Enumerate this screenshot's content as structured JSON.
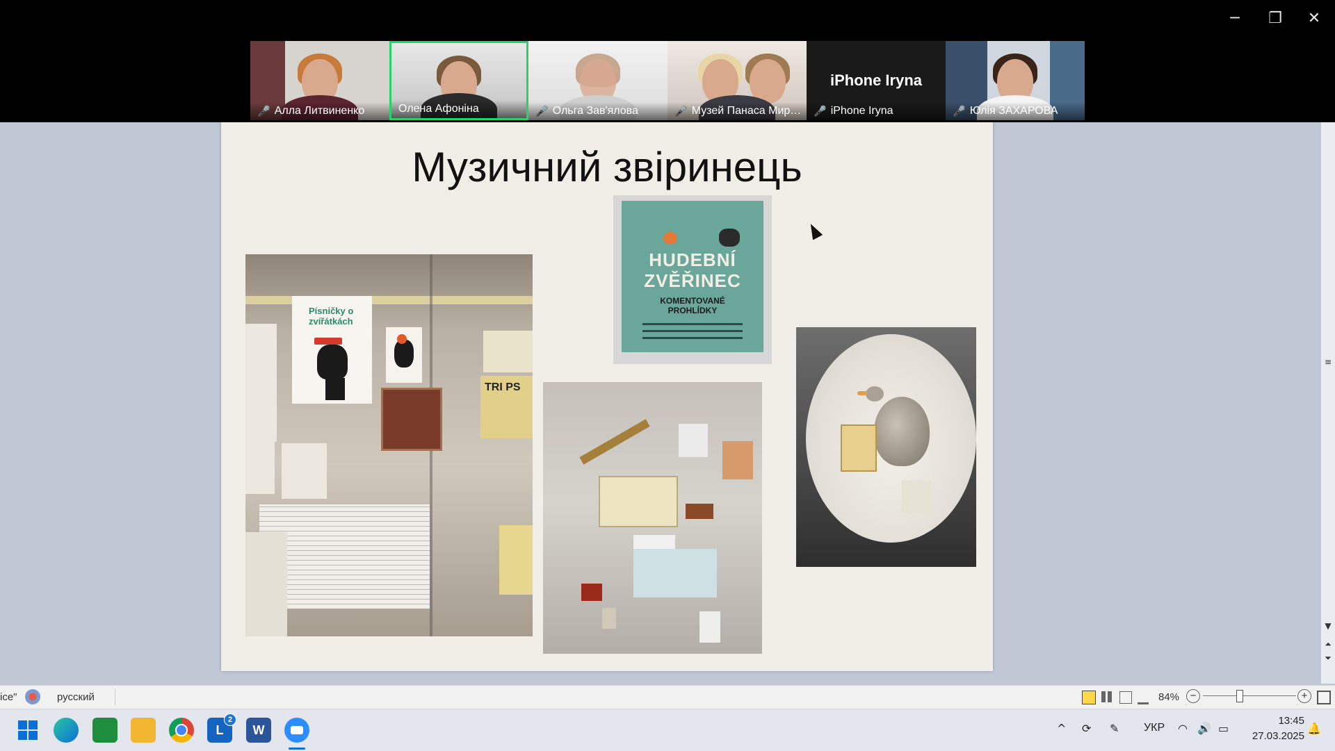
{
  "window": {
    "min_glyph": "─",
    "restore_glyph": "❐",
    "close_glyph": "✕"
  },
  "participants": [
    {
      "name": "Алла Литвиненко",
      "muted": true
    },
    {
      "name": "Олена Афоніна",
      "muted": false,
      "active": true
    },
    {
      "name": "Ольга Зав'ялова",
      "muted": true
    },
    {
      "name": "Музей Панаса Мирно...",
      "muted": true
    },
    {
      "name": "iPhone Iryna",
      "muted": true,
      "label": "iPhone Iryna"
    },
    {
      "name": "Юлія ЗАХАРОВА",
      "muted": true
    }
  ],
  "slide": {
    "title": "Музичний звіринець",
    "poster": {
      "title_line1": "HUDEBNÍ",
      "title_line2": "ZVĚŘINEC",
      "subtitle_line1": "KOMENTOVANÉ",
      "subtitle_line2": "PROHLÍDKY"
    },
    "book_title": "Písničky o zvířátkách",
    "sign_text": "TRI PS"
  },
  "statusbar": {
    "left_text": "ice\"",
    "language": "русский",
    "zoom": "84%",
    "minus": "−",
    "plus": "+"
  },
  "tray": {
    "chevron": "^",
    "language": "УКР",
    "time": "13:45",
    "date": "27.03.2025",
    "badge_count": "2"
  },
  "colors": {
    "accent_active": "#25d366",
    "muted_icon": "#e23b3b",
    "taskbar": "#e3e6ec"
  }
}
